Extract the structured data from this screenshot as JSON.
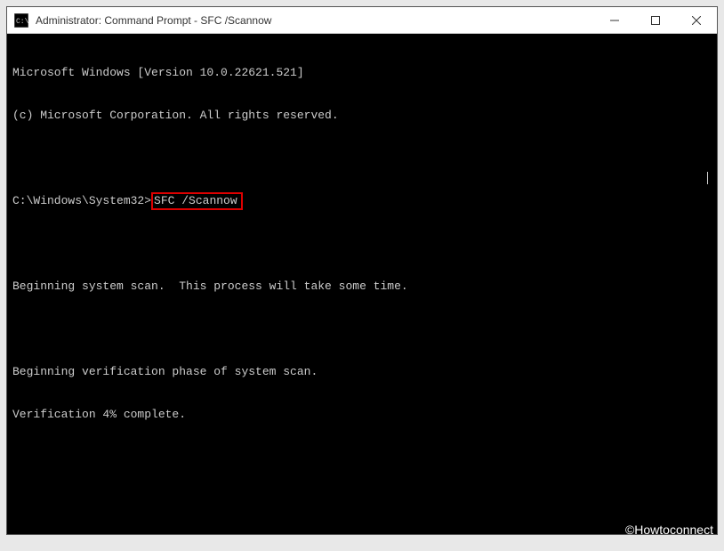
{
  "titlebar": {
    "title": "Administrator: Command Prompt - SFC  /Scannow"
  },
  "terminal": {
    "line1": "Microsoft Windows [Version 10.0.22621.521]",
    "line2": "(c) Microsoft Corporation. All rights reserved.",
    "prompt_path": "C:\\Windows\\System32>",
    "command": "SFC /Scannow",
    "line5": "Beginning system scan.  This process will take some time.",
    "line7": "Beginning verification phase of system scan.",
    "line8": "Verification 4% complete."
  },
  "watermark": "©Howtoconnect"
}
